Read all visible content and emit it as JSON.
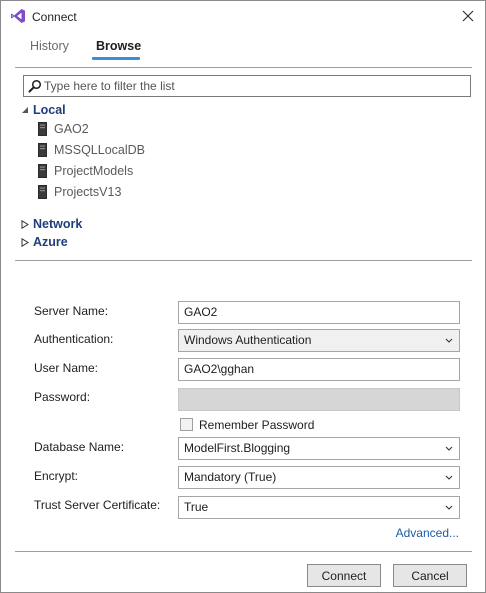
{
  "window": {
    "title": "Connect"
  },
  "tabs": [
    {
      "label": "History",
      "active": false
    },
    {
      "label": "Browse",
      "active": true
    }
  ],
  "filter": {
    "placeholder": "Type here to filter the list",
    "value": ""
  },
  "tree": {
    "local": {
      "label": "Local",
      "expanded": true,
      "items": [
        "GAO2",
        "MSSQLLocalDB",
        "ProjectModels",
        "ProjectsV13"
      ]
    },
    "network": {
      "label": "Network",
      "expanded": false
    },
    "azure": {
      "label": "Azure",
      "expanded": false
    }
  },
  "form": {
    "server_name_label": "Server Name:",
    "server_name_value": "GAO2",
    "authentication_label": "Authentication:",
    "authentication_value": "Windows Authentication",
    "user_name_label": "User Name:",
    "user_name_value": "GAO2\\gghan",
    "password_label": "Password:",
    "password_value": "",
    "remember_password_label": "Remember Password",
    "remember_password_checked": false,
    "database_name_label": "Database Name:",
    "database_name_value": "ModelFirst.Blogging",
    "encrypt_label": "Encrypt:",
    "encrypt_value": "Mandatory (True)",
    "trust_cert_label": "Trust Server Certificate:",
    "trust_cert_value": "True",
    "advanced_link": "Advanced..."
  },
  "buttons": {
    "connect": "Connect",
    "cancel": "Cancel"
  },
  "icons": {
    "app": "visual-studio-logo-icon",
    "close": "close-icon",
    "search": "search-icon",
    "server": "server-icon",
    "expanded": "triangle-down-icon",
    "collapsed": "triangle-right-icon",
    "dropdown": "chevron-down-icon"
  },
  "colors": {
    "accent": "#3b8ed6",
    "group_label": "#1f3f7a",
    "link": "#1e5aa8",
    "logo": "#7b4fc9"
  }
}
